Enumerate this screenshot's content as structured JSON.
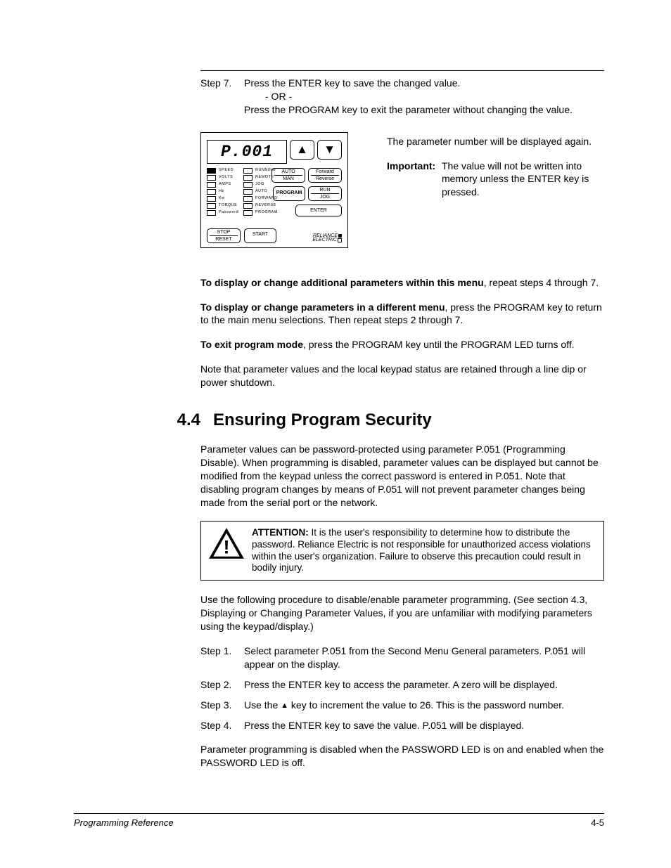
{
  "step7": {
    "label": "Step 7.",
    "line1": "Press the ENTER key to save the changed value.",
    "or": "- OR -",
    "line2": "Press the PROGRAM key to exit the parameter without changing the value."
  },
  "keypad": {
    "display": "P.001",
    "arrow_up": "▲",
    "arrow_down": "▼",
    "btn_auto_man_top": "AUTO",
    "btn_auto_man_bot": "MAN",
    "btn_fr_top": "Forward",
    "btn_fr_bot": "Reverse",
    "btn_program": "PROGRAM",
    "btn_runjog_top": "RUN",
    "btn_runjog_bot": "JOG",
    "btn_enter": "ENTER",
    "btn_stopreset_top": "STOP",
    "btn_stopreset_bot": "RESET",
    "btn_start": "START",
    "brand_top": "RELIANCE",
    "brand_bot": "ELECTRIC",
    "leds_left": [
      "SPEED",
      "VOLTS",
      "AMPS",
      "Hz",
      "Kw",
      "TORQUE",
      "Password"
    ],
    "leds_right": [
      "RUNNING",
      "REMOTE",
      "JOG",
      "AUTO",
      "FORWARD",
      "REVERSE",
      "PROGRAM"
    ]
  },
  "side": {
    "p1": "The parameter number will be displayed again.",
    "imp_label": "Important:",
    "imp_text": "The value will not be written into memory unless the ENTER key is pressed."
  },
  "paras": {
    "p1a": "To display or change additional parameters within this menu",
    "p1b": ", repeat steps 4 through 7.",
    "p2a": "To display or change parameters in a different menu",
    "p2b": ", press the PROGRAM key to return to the main menu selections. Then repeat steps 2 through 7.",
    "p3a": "To exit program mode",
    "p3b": ", press the PROGRAM key until the PROGRAM LED turns off.",
    "p4": "Note that parameter values and the local keypad status are retained through a line dip or power shutdown."
  },
  "section": {
    "num": "4.4",
    "title": "Ensuring Program Security",
    "intro": "Parameter values can be password-protected using parameter P.051 (Programming Disable). When programming is disabled, parameter values can be displayed but cannot be modified from the keypad unless the correct password is entered in P.051. Note that disabling program changes by means of P.051 will not prevent parameter changes being made from the serial port or the network."
  },
  "attention": {
    "label": "ATTENTION:",
    "text": " It is the user's responsibility to determine how to distribute the password. Reliance Electric is not responsible for unauthorized access violations within the user's organization. Failure to observe this precaution could result in bodily injury."
  },
  "use_proc": "Use the following procedure to disable/enable parameter programming. (See section 4.3, Displaying or Changing Parameter Values, if you are unfamiliar with modifying parameters using the keypad/display.)",
  "steps": [
    {
      "label": "Step 1.",
      "text": "Select parameter P.051 from the Second Menu General parameters. P.051 will appear on the display."
    },
    {
      "label": "Step 2.",
      "text": "Press the ENTER key to access the parameter. A zero will be displayed."
    },
    {
      "label": "Step 3.",
      "text_a": "Use the ",
      "sym": "▲",
      "text_b": " key to increment the value to 26. This is the password number."
    },
    {
      "label": "Step 4.",
      "text": "Press the ENTER key to save the value. P.051 will be displayed."
    }
  ],
  "closing": "Parameter programming is disabled when the PASSWORD LED is on and enabled when the PASSWORD LED is off.",
  "footer": {
    "left": "Programming Reference",
    "right": "4-5"
  }
}
